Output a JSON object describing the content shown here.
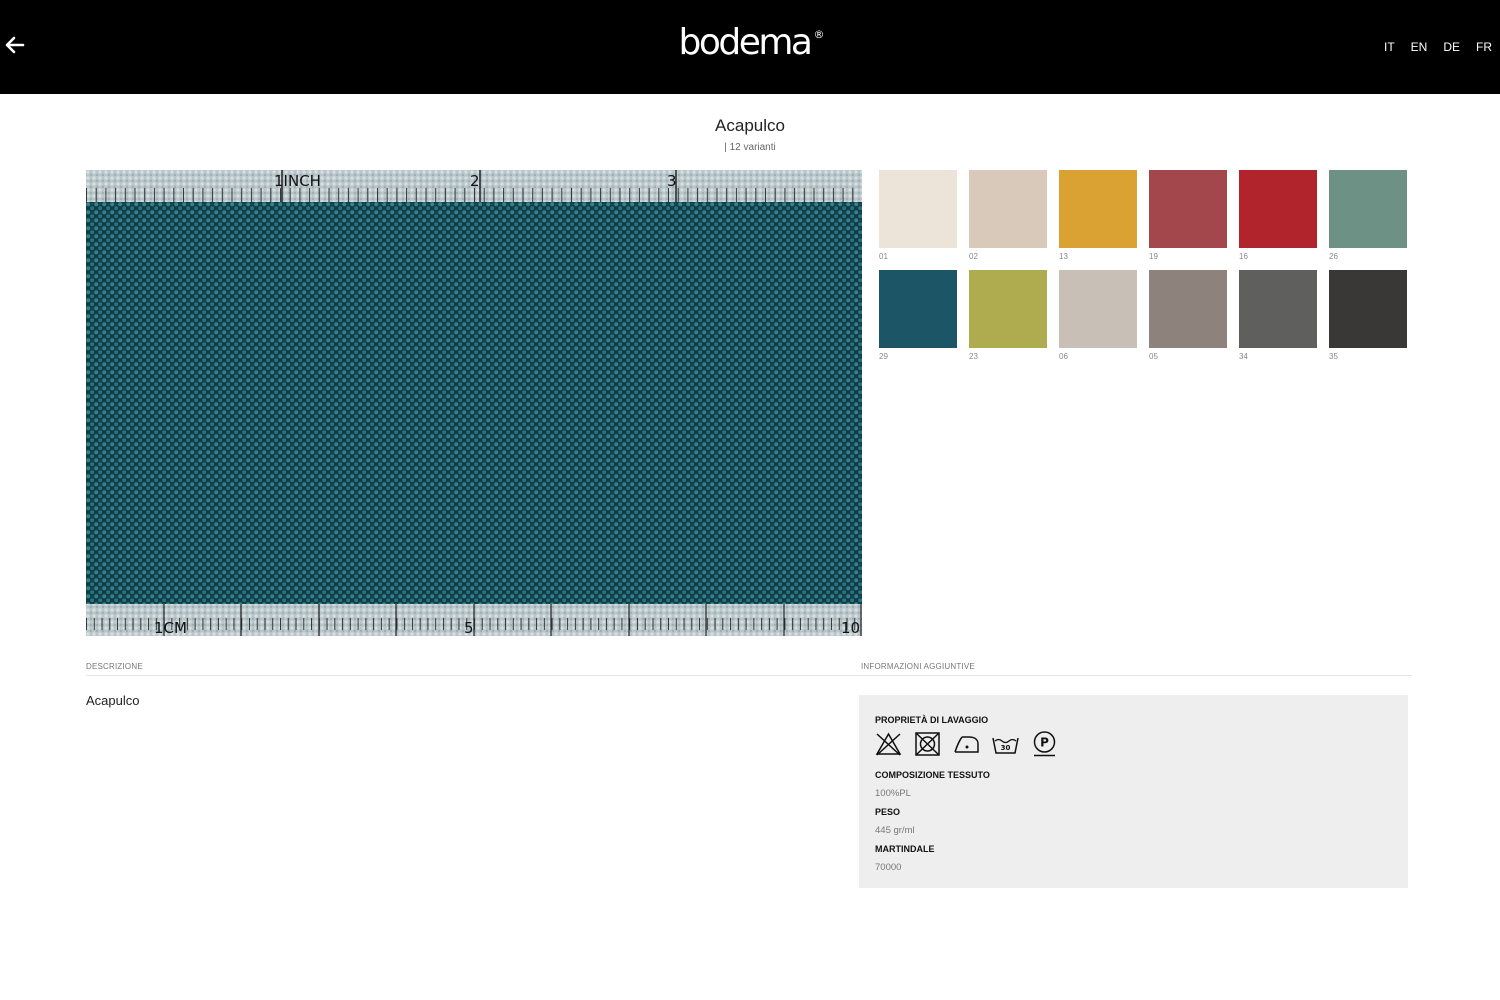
{
  "header": {
    "brand": "bodema",
    "brand_mark": "®",
    "languages": [
      "IT",
      "EN",
      "DE",
      "FR"
    ]
  },
  "product": {
    "title": "Acapulco",
    "variants": "| 12 varianti",
    "fabric_color": "#1d5a66"
  },
  "ruler": {
    "top_labels": [
      "1INCH",
      "2",
      "3"
    ],
    "bottom_labels": [
      "1CM",
      "5",
      "10"
    ]
  },
  "swatches": [
    {
      "code": "01",
      "color": "#ece4d8"
    },
    {
      "code": "02",
      "color": "#d9c9bb"
    },
    {
      "code": "13",
      "color": "#d9a233"
    },
    {
      "code": "19",
      "color": "#a3474d"
    },
    {
      "code": "16",
      "color": "#b1242b"
    },
    {
      "code": "26",
      "color": "#6e9185"
    },
    {
      "code": "29",
      "color": "#1c5566"
    },
    {
      "code": "23",
      "color": "#aeac4f"
    },
    {
      "code": "06",
      "color": "#c8c0b7"
    },
    {
      "code": "05",
      "color": "#8d837c"
    },
    {
      "code": "34",
      "color": "#5f605e"
    },
    {
      "code": "35",
      "color": "#3a3836"
    }
  ],
  "sections": {
    "description_label": "DESCRIZIONE",
    "info_label": "INFORMAZIONI AGGIUNTIVE"
  },
  "description": {
    "text": "Acapulco"
  },
  "info": {
    "washing_heading": "PROPRIETÀ DI LAVAGGIO",
    "washing_icons": [
      "no-bleach-icon",
      "no-tumble-dry-icon",
      "iron-low-icon",
      "wash-30-icon",
      "dry-clean-p-icon"
    ],
    "wash_temp": "30",
    "dry_clean_letter": "P",
    "composition_heading": "COMPOSIZIONE TESSUTO",
    "composition": "100%PL",
    "weight_heading": "PESO",
    "weight": "445 gr/ml",
    "martindale_heading": "MARTINDALE",
    "martindale": "70000"
  }
}
